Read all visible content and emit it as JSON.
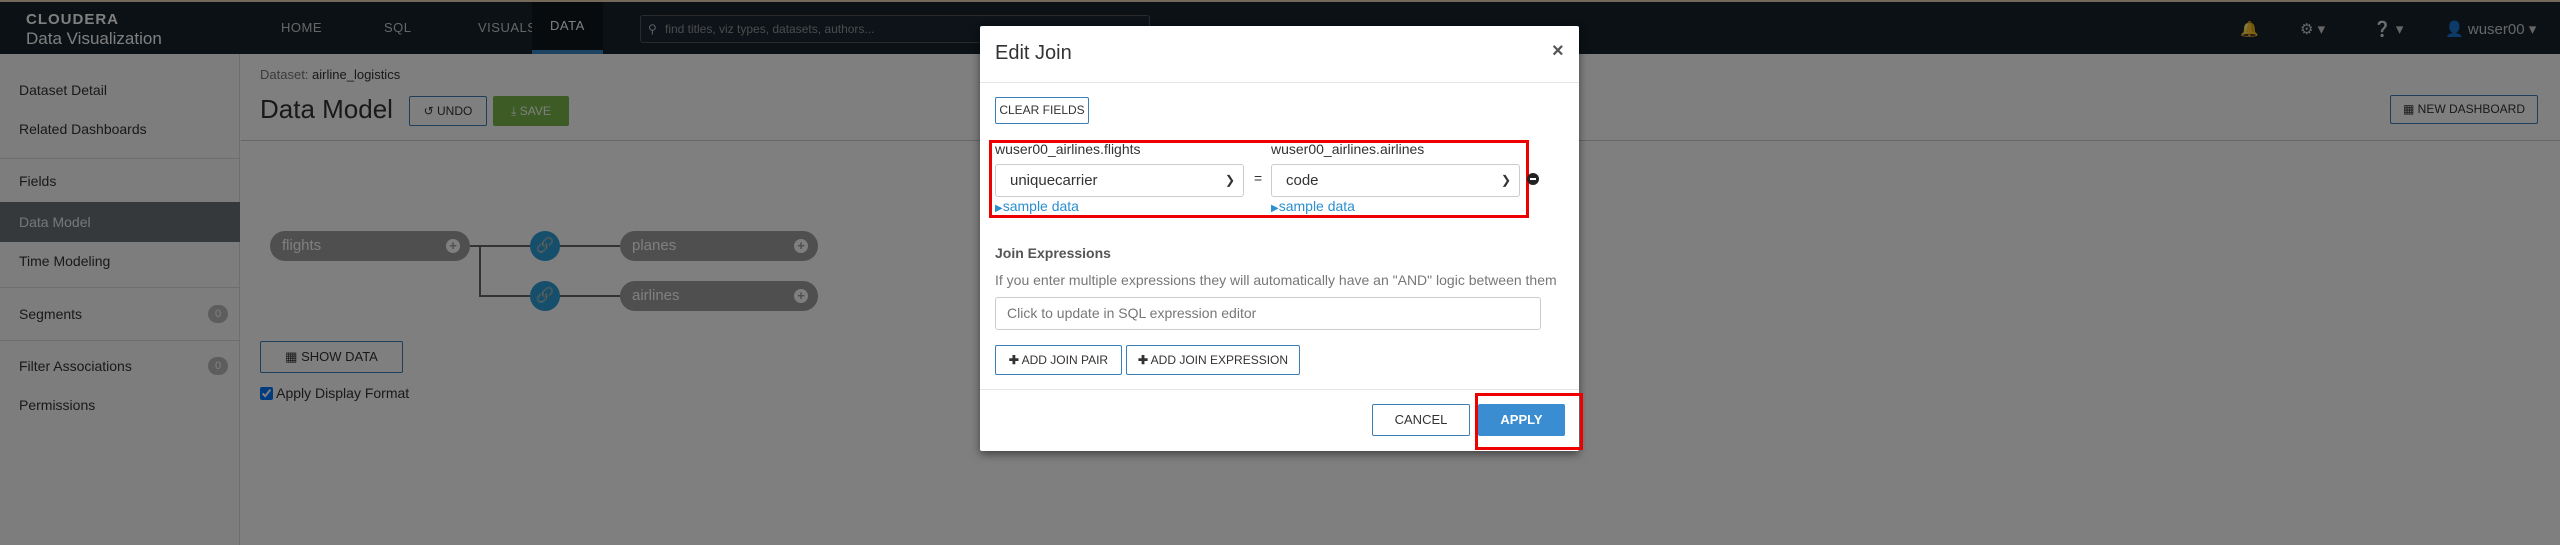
{
  "brand": {
    "name": "CLOUDERA",
    "product": "Data Visualization"
  },
  "nav": [
    {
      "label": "HOME"
    },
    {
      "label": "SQL"
    },
    {
      "label": "VISUALS"
    },
    {
      "label": "DATA",
      "active": true
    }
  ],
  "search": {
    "placeholder": "find titles, viz types, datasets, authors..."
  },
  "user": {
    "name": "wuser00"
  },
  "sidebar": {
    "items": [
      {
        "label": "Dataset Detail"
      },
      {
        "label": "Related Dashboards"
      },
      {
        "label": "Fields"
      },
      {
        "label": "Data Model"
      },
      {
        "label": "Time Modeling"
      },
      {
        "label": "Segments",
        "badge": "0"
      },
      {
        "label": "Filter Associations",
        "badge": "0"
      },
      {
        "label": "Permissions"
      }
    ]
  },
  "main": {
    "breadcrumb_label": "Dataset:",
    "breadcrumb_value": "airline_logistics",
    "title": "Data Model",
    "undo": "UNDO",
    "save": "SAVE",
    "new_dashboard": "NEW DASHBOARD",
    "show_data": "SHOW DATA",
    "apply_display_format": "Apply Display Format",
    "tables": [
      "flights",
      "planes",
      "airlines"
    ]
  },
  "modal": {
    "title": "Edit Join",
    "clear_fields": "CLEAR FIELDS",
    "left_table": "wuser00_airlines.flights",
    "right_table": "wuser00_airlines.airlines",
    "left_value": "uniquecarrier",
    "right_value": "code",
    "equals": "=",
    "sample_data": "sample data",
    "join_expressions": "Join Expressions",
    "help": "If you enter multiple expressions they will automatically have an \"AND\" logic between them",
    "expr_placeholder": "Click to update in SQL expression editor",
    "add_pair": "ADD JOIN PAIR",
    "add_expr": "ADD JOIN EXPRESSION",
    "cancel": "CANCEL",
    "apply": "APPLY"
  },
  "colors": {
    "accent": "#3a87c6",
    "save": "#7ab648",
    "highlight": "#ee0000"
  }
}
